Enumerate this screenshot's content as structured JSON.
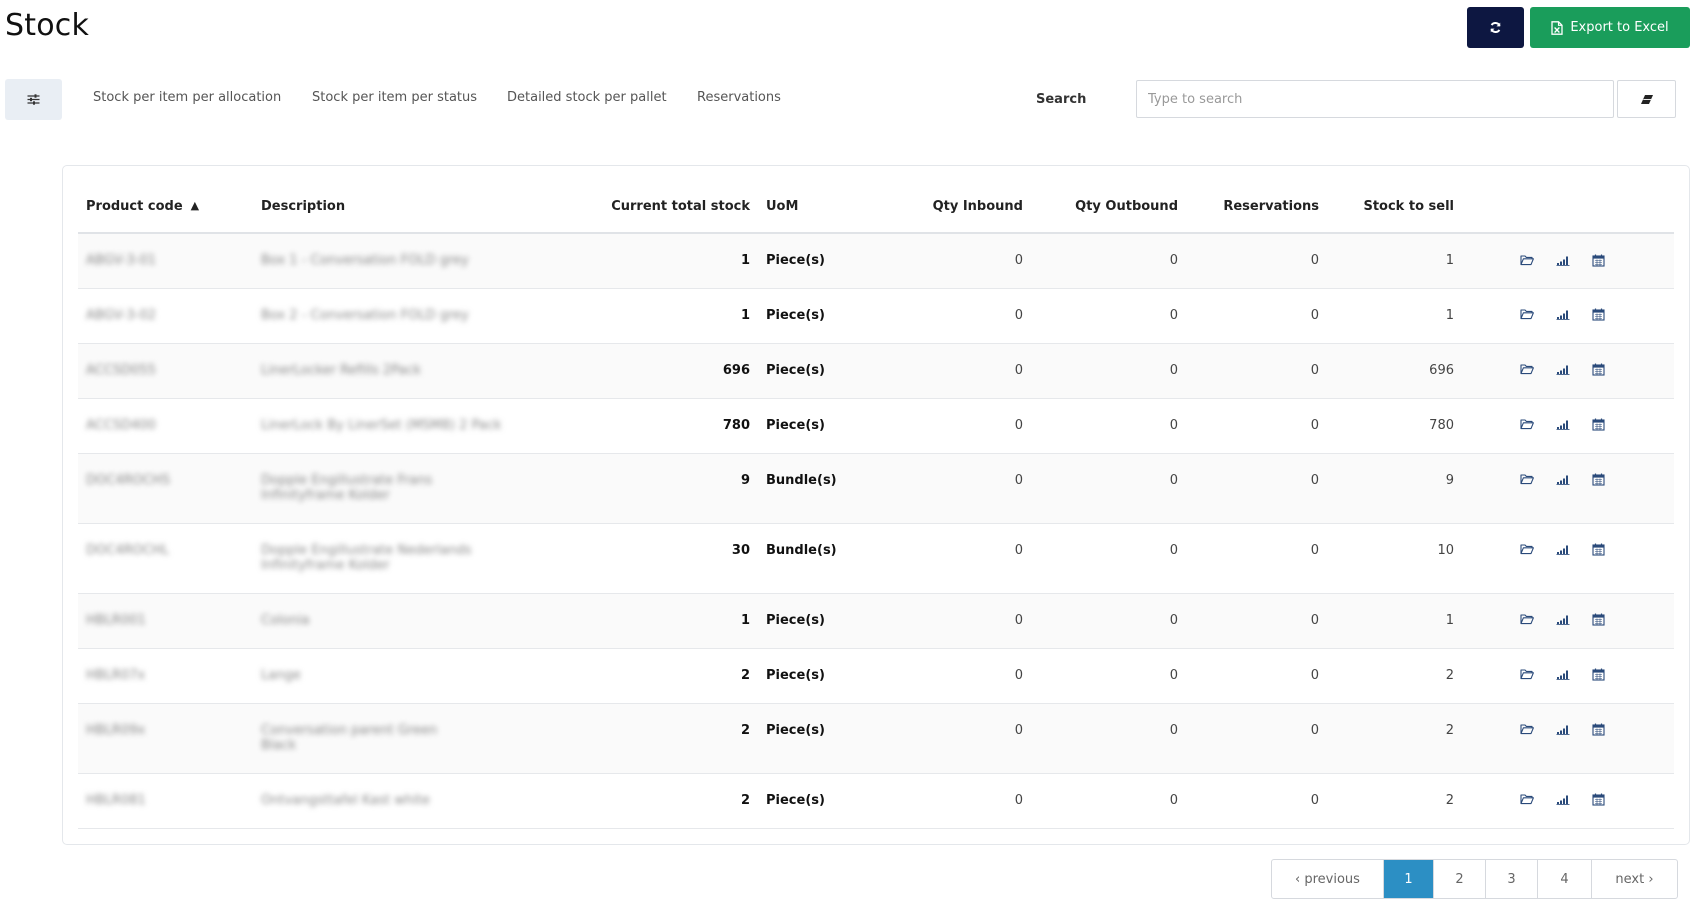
{
  "header": {
    "title": "Stock",
    "export_label": "Export to Excel"
  },
  "tabs": [
    {
      "label": "Stock per item per allocation"
    },
    {
      "label": "Stock per item per status"
    },
    {
      "label": "Detailed stock per pallet"
    },
    {
      "label": "Reservations"
    }
  ],
  "search": {
    "label": "Search",
    "placeholder": "Type to search"
  },
  "table": {
    "columns": [
      "Product code",
      "Description",
      "Current total stock",
      "UoM",
      "Qty Inbound",
      "Qty Outbound",
      "Reservations",
      "Stock to sell"
    ],
    "rows": [
      {
        "code": "ABGV-3-01",
        "desc1": "Box 1 - Conversation FOLD grey",
        "desc2": "",
        "stock": "1",
        "uom": "Piece(s)",
        "inbound": "0",
        "outbound": "0",
        "reservations": "0",
        "sell": "1"
      },
      {
        "code": "ABGV-3-02",
        "desc1": "Box 2 - Conversation FOLD grey",
        "desc2": "",
        "stock": "1",
        "uom": "Piece(s)",
        "inbound": "0",
        "outbound": "0",
        "reservations": "0",
        "sell": "1"
      },
      {
        "code": "ACCSD055",
        "desc1": "LinerLocker Refills 2Pack",
        "desc2": "",
        "stock": "696",
        "uom": "Piece(s)",
        "inbound": "0",
        "outbound": "0",
        "reservations": "0",
        "sell": "696"
      },
      {
        "code": "ACCSD400",
        "desc1": "LinerLock By LinerSet (MSM8) 2 Pack",
        "desc2": "",
        "stock": "780",
        "uom": "Piece(s)",
        "inbound": "0",
        "outbound": "0",
        "reservations": "0",
        "sell": "780"
      },
      {
        "code": "DOC4ROCHS",
        "desc1": "Dopple Engillustrate Frans",
        "desc2": "Infinityframe Kolder",
        "stock": "9",
        "uom": "Bundle(s)",
        "inbound": "0",
        "outbound": "0",
        "reservations": "0",
        "sell": "9"
      },
      {
        "code": "DOC4ROCHL",
        "desc1": "Dopple Engillustrate Nederlands",
        "desc2": "Infinityframe Kolder",
        "stock": "30",
        "uom": "Bundle(s)",
        "inbound": "0",
        "outbound": "0",
        "reservations": "0",
        "sell": "10"
      },
      {
        "code": "HBLR001",
        "desc1": "Colonia",
        "desc2": "",
        "stock": "1",
        "uom": "Piece(s)",
        "inbound": "0",
        "outbound": "0",
        "reservations": "0",
        "sell": "1"
      },
      {
        "code": "HBLR07x",
        "desc1": "Lange",
        "desc2": "",
        "stock": "2",
        "uom": "Piece(s)",
        "inbound": "0",
        "outbound": "0",
        "reservations": "0",
        "sell": "2"
      },
      {
        "code": "HBLR09x",
        "desc1": "Conversation parent Green",
        "desc2": "Black",
        "stock": "2",
        "uom": "Piece(s)",
        "inbound": "0",
        "outbound": "0",
        "reservations": "0",
        "sell": "2"
      },
      {
        "code": "HBLR081",
        "desc1": "Ontvangsttafel Kast white",
        "desc2": "",
        "stock": "2",
        "uom": "Piece(s)",
        "inbound": "0",
        "outbound": "0",
        "reservations": "0",
        "sell": "2"
      }
    ]
  },
  "pagination": {
    "previous": "‹ previous",
    "pages": [
      "1",
      "2",
      "3",
      "4"
    ],
    "next": "next ›",
    "active_page": "1"
  },
  "colors": {
    "refresh_bg": "#0d1741",
    "export_bg": "#1a9d5b",
    "active_page_bg": "#2c8fc4",
    "action_icon": "#2a4a7a"
  },
  "icons": [
    "refresh-icon",
    "excel-file-icon",
    "sliders-icon",
    "eraser-icon",
    "sort-up-icon",
    "folder-icon",
    "bar-chart-icon",
    "calendar-icon"
  ]
}
